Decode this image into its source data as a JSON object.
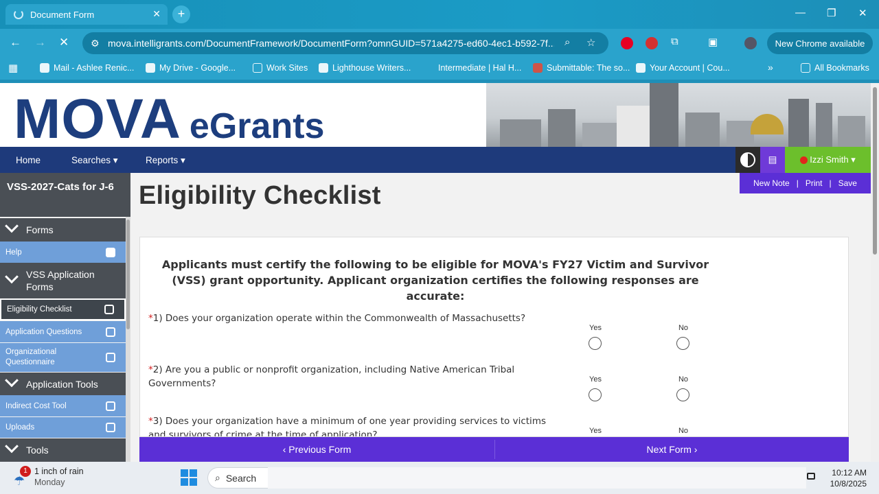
{
  "browser": {
    "tab_title": "Document Form",
    "tab_close": "✕",
    "new_tab": "+",
    "url": "mova.intelligrants.com/DocumentFramework/DocumentForm?omnGUID=571a4275-ed60-4ec1-b592-7f...",
    "update_pill": "New Chrome available",
    "bookmarks": [
      "Mail - Ashlee Renic...",
      "My Drive - Google...",
      "Work Sites",
      "Lighthouse Writers...",
      "Intermediate | Hal H...",
      "Submittable: The so...",
      "Your Account | Cou..."
    ],
    "more_bookmarks": "»",
    "all_bookmarks": "All Bookmarks"
  },
  "site": {
    "logo_big": "MOVA",
    "logo_small": "eGrants",
    "nav": {
      "home": "Home",
      "searches": "Searches ▾",
      "reports": "Reports ▾"
    },
    "user": "Izzi Smith ▾",
    "actions": {
      "new_note": "New Note",
      "print": "Print",
      "save": "Save",
      "sep1": "|",
      "sep2": "|"
    }
  },
  "sidebar": {
    "project": "VSS-2027-Cats for J-6",
    "sections": {
      "forms": "Forms",
      "vss_forms": "VSS Application Forms",
      "app_tools": "Application Tools",
      "tools": "Tools"
    },
    "items": {
      "help": "Help",
      "eligibility": "Eligibility Checklist",
      "app_questions": "Application Questions",
      "org_questionnaire": "Organizational Questionnaire",
      "indirect": "Indirect Cost Tool",
      "uploads": "Uploads"
    }
  },
  "main": {
    "title": "Eligibility Checklist",
    "intro": "Applicants must certify the following to be eligible for MOVA's FY27 Victim and Survivor (VSS) grant opportunity. Applicant organization certifies the following responses are accurate:",
    "required_mark": "*",
    "yes": "Yes",
    "no": "No",
    "questions": [
      "1) Does your organization operate within the Commonwealth of Massachusetts?",
      "2) Are you a public or nonprofit organization, including Native American Tribal Governments?",
      "3) Does your organization have a minimum of one year providing services to victims and survivors of crime at the time of application?"
    ],
    "prev": "‹ Previous Form",
    "next": "Next Form ›"
  },
  "taskbar": {
    "weather_badge": "1",
    "weather_line1": "1 inch of rain",
    "weather_line2": "Monday",
    "search": "Search",
    "time": "10:12 AM",
    "date": "10/8/2025"
  },
  "colors": {
    "navy": "#1e3a7b",
    "purple": "#5b2fd6",
    "green": "#6cbf2c",
    "sidebar_blue": "#6f9fd9"
  }
}
